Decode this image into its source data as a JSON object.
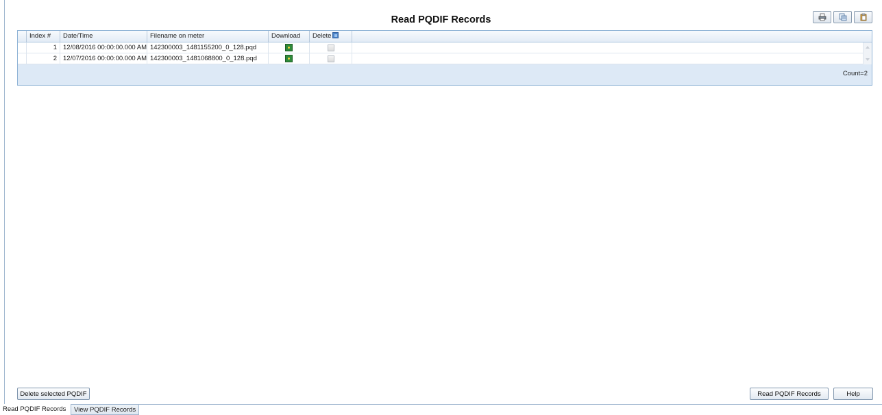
{
  "page": {
    "title": "Read PQDIF Records"
  },
  "toolbar": {
    "buttons": [
      "print-icon",
      "export-icon",
      "clipboard-icon"
    ]
  },
  "grid": {
    "columns": [
      "Index #",
      "Date/Time",
      "Filename on meter",
      "Download",
      "Delete"
    ],
    "rows": [
      {
        "index": "1",
        "datetime": "12/08/2016 00:00:00.000 AM",
        "filename": "142300003_1481155200_0_128.pqd",
        "delete_checked": false
      },
      {
        "index": "2",
        "datetime": "12/07/2016 00:00:00.000 AM",
        "filename": "142300003_1481068800_0_128.pqd",
        "delete_checked": false
      }
    ],
    "count_label": "Count=2"
  },
  "buttons": {
    "delete_selected": "Delete selected PQDIF",
    "read_records": "Read PQDIF Records",
    "help": "Help"
  },
  "tabs": [
    {
      "label": "Read PQDIF Records",
      "active": true
    },
    {
      "label": "View PQDIF Records",
      "active": false
    }
  ],
  "colors": {
    "accent": "#8fb3d6",
    "grid_footer": "#dde9f6",
    "download_icon": "#2f8a3a"
  }
}
